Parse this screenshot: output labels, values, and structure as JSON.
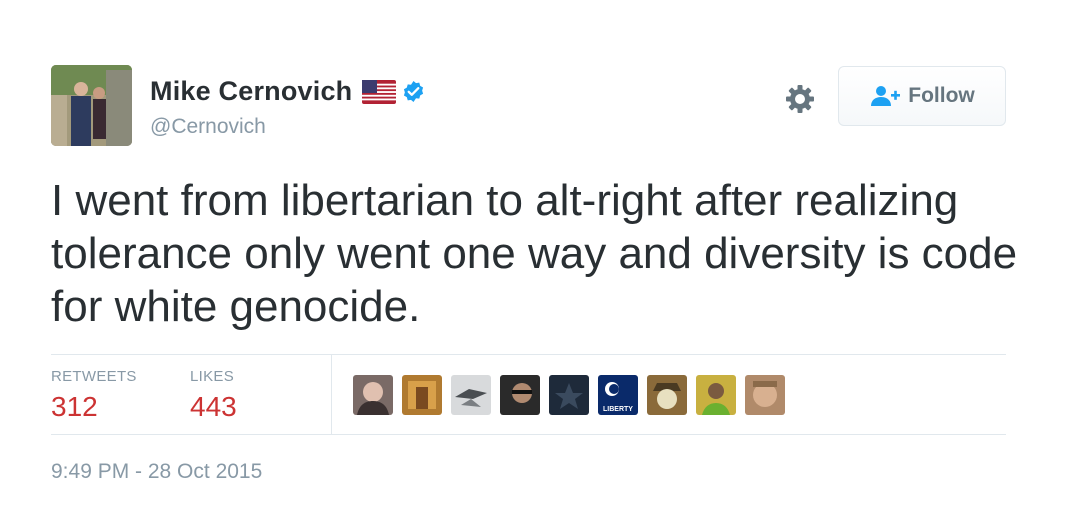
{
  "tweet": {
    "display_name": "Mike Cernovich",
    "handle": "@Cernovich",
    "text": "I went from libertarian to alt-right after realizing tolerance only went one way and diversity is code for white genocide.",
    "timestamp": "9:49 PM - 28 Oct 2015",
    "liker_badge_text": "LIBERTY"
  },
  "actions": {
    "follow_label": "Follow",
    "settings_icon": "gear-icon",
    "follow_icon": "add-user-icon"
  },
  "stats": {
    "retweets_label": "RETWEETS",
    "retweets_value": "312",
    "likes_label": "LIKES",
    "likes_value": "443"
  },
  "colors": {
    "stat_value": "#cc3333",
    "secondary_text": "#8899a6",
    "verified_badge": "#1da1f2",
    "follow_icon": "#1da1f2"
  }
}
